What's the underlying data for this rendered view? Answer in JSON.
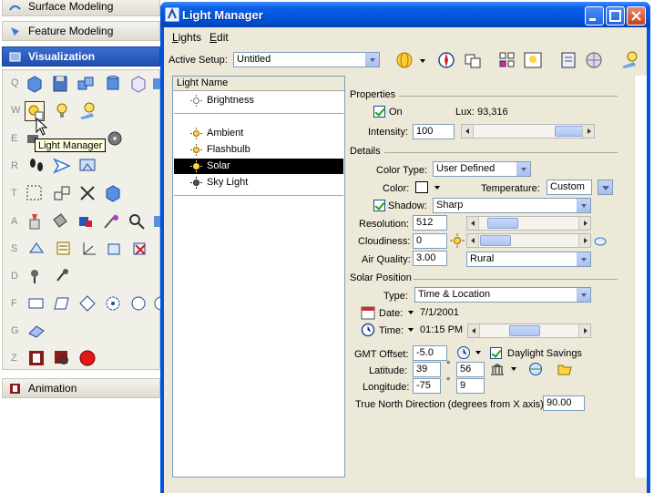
{
  "left_panel": {
    "headers": [
      {
        "label": "Surface Modeling"
      },
      {
        "label": "Feature Modeling"
      },
      {
        "label": "Visualization"
      },
      {
        "label": "Animation"
      }
    ],
    "row_letters": [
      "Q",
      "W",
      "E",
      "R",
      "T",
      "A",
      "S",
      "D",
      "F",
      "G",
      "Z"
    ],
    "tooltip": "Light Manager"
  },
  "window": {
    "title": "Light Manager",
    "menu": [
      {
        "label": "Lights",
        "mnemonic": "L"
      },
      {
        "label": "Edit",
        "mnemonic": "E"
      }
    ],
    "active_setup": {
      "label": "Active Setup:",
      "value": "Untitled"
    }
  },
  "light_list": {
    "header": "Light Name",
    "items": [
      {
        "label": "Brightness",
        "selected": false
      },
      {
        "label": "Ambient",
        "selected": false
      },
      {
        "label": "Flashbulb",
        "selected": false
      },
      {
        "label": "Solar",
        "selected": true
      },
      {
        "label": "Sky Light",
        "selected": false
      }
    ]
  },
  "properties": {
    "title": "Properties",
    "on_label": "On",
    "on_checked": true,
    "lux_label": "Lux:",
    "lux_value": "93,316",
    "intensity_label": "Intensity:",
    "intensity_value": "100"
  },
  "details": {
    "title": "Details",
    "color_type_label": "Color Type:",
    "color_type_value": "User Defined",
    "color_label": "Color:",
    "temperature_label": "Temperature:",
    "temperature_value": "Custom",
    "shadow_label": "Shadow:",
    "shadow_checked": true,
    "shadow_value": "Sharp",
    "resolution_label": "Resolution:",
    "resolution_value": "512",
    "cloudiness_label": "Cloudiness:",
    "cloudiness_value": "0",
    "air_quality_label": "Air Quality:",
    "air_quality_value": "3.00",
    "air_quality_option": "Rural"
  },
  "solar_position": {
    "title": "Solar Position",
    "type_label": "Type:",
    "type_value": "Time & Location",
    "date_label": "Date:",
    "date_value": "7/1/2001",
    "time_label": "Time:",
    "time_value": "01:15 PM",
    "gmt_label": "GMT Offset:",
    "gmt_value": "-5.0",
    "daylight_label": "Daylight Savings",
    "daylight_checked": true,
    "latitude_label": "Latitude:",
    "latitude_deg": "39",
    "latitude_min": "56",
    "longitude_label": "Longitude:",
    "longitude_deg": "-75",
    "longitude_min": "9",
    "degree_symbol": "°",
    "north_label": "True North Direction (degrees from X axis):",
    "north_value": "90.00"
  },
  "colors": {
    "title_bar": "#0054e3",
    "selection": "#000000",
    "window_bg": "#ece9d8",
    "visualization_header": "#1f4fab"
  }
}
